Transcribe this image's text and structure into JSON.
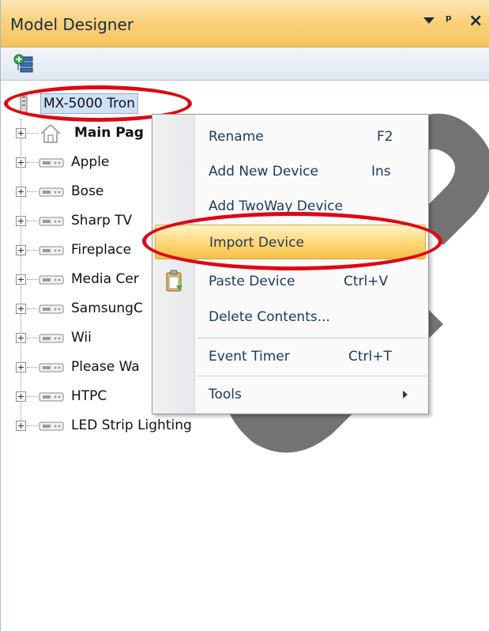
{
  "panel": {
    "title": "Model Designer",
    "title_buttons": [
      "dropdown-arrow",
      "pin",
      "close"
    ],
    "pin_glyph": "p",
    "close_glyph": "×"
  },
  "toolbar": {
    "icons": [
      "add-device-tree-icon"
    ]
  },
  "tree": {
    "root": {
      "label": "MX-5000 Tron",
      "icon": "remote-icon",
      "selected": true
    },
    "main_page": {
      "label": "Main Pag",
      "icon": "house-icon"
    },
    "devices": [
      {
        "label": "Apple"
      },
      {
        "label": "Bose"
      },
      {
        "label": "Sharp TV"
      },
      {
        "label": "Fireplace"
      },
      {
        "label": "Media Cer"
      },
      {
        "label": "SamsungC"
      },
      {
        "label": "Wii"
      },
      {
        "label": "Please Wa"
      },
      {
        "label": "HTPC"
      },
      {
        "label": "LED Strip Lighting"
      }
    ]
  },
  "context_menu": {
    "items": [
      {
        "label": "Rename",
        "shortcut": "F2"
      },
      {
        "label": "Add New Device",
        "shortcut": "Ins"
      },
      {
        "label": "Add TwoWay Device",
        "shortcut": ""
      },
      {
        "label": "Import Device",
        "shortcut": "",
        "highlighted": true
      },
      {
        "label": "Paste Device",
        "shortcut": "Ctrl+V",
        "icon": "clipboard-paste-icon"
      },
      {
        "label": "Delete Contents...",
        "shortcut": ""
      },
      {
        "label": "Event Timer",
        "shortcut": "Ctrl+T"
      },
      {
        "label": "Tools",
        "shortcut": "",
        "submenu": true
      }
    ]
  },
  "annotations": {
    "highlight_color": "#e00712",
    "watermark_color": "#000000",
    "highlighted_targets": [
      "tree-root",
      "import-device"
    ]
  },
  "colors": {
    "title_bar": "#f9d27d",
    "menu_text": "#1f3a60",
    "selection": "#cfe0f6",
    "menu_highlight": "#ffd97a"
  }
}
